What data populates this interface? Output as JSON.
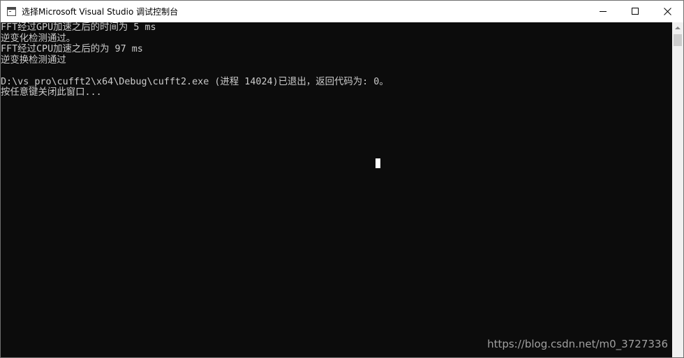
{
  "window": {
    "title": "选择Microsoft Visual Studio 调试控制台"
  },
  "icons": {
    "app": "console-app-icon",
    "minimize": "minimize-icon",
    "maximize": "maximize-icon",
    "close": "close-icon",
    "scroll_up": "chevron-up-icon"
  },
  "console": {
    "lines": [
      "FFT经过GPU加速之后的时间为 5 ms",
      "逆变化检测通过。",
      "FFT经过CPU加速之后的为 97 ms",
      "逆变换检测通过",
      "",
      "D:\\vs_pro\\cufft2\\x64\\Debug\\cufft2.exe (进程 14024)已退出，返回代码为: 0。",
      "按任意键关闭此窗口..."
    ],
    "text_color": "#cccccc",
    "background": "#0c0c0c"
  },
  "watermark": "https://blog.csdn.net/m0_3727336"
}
